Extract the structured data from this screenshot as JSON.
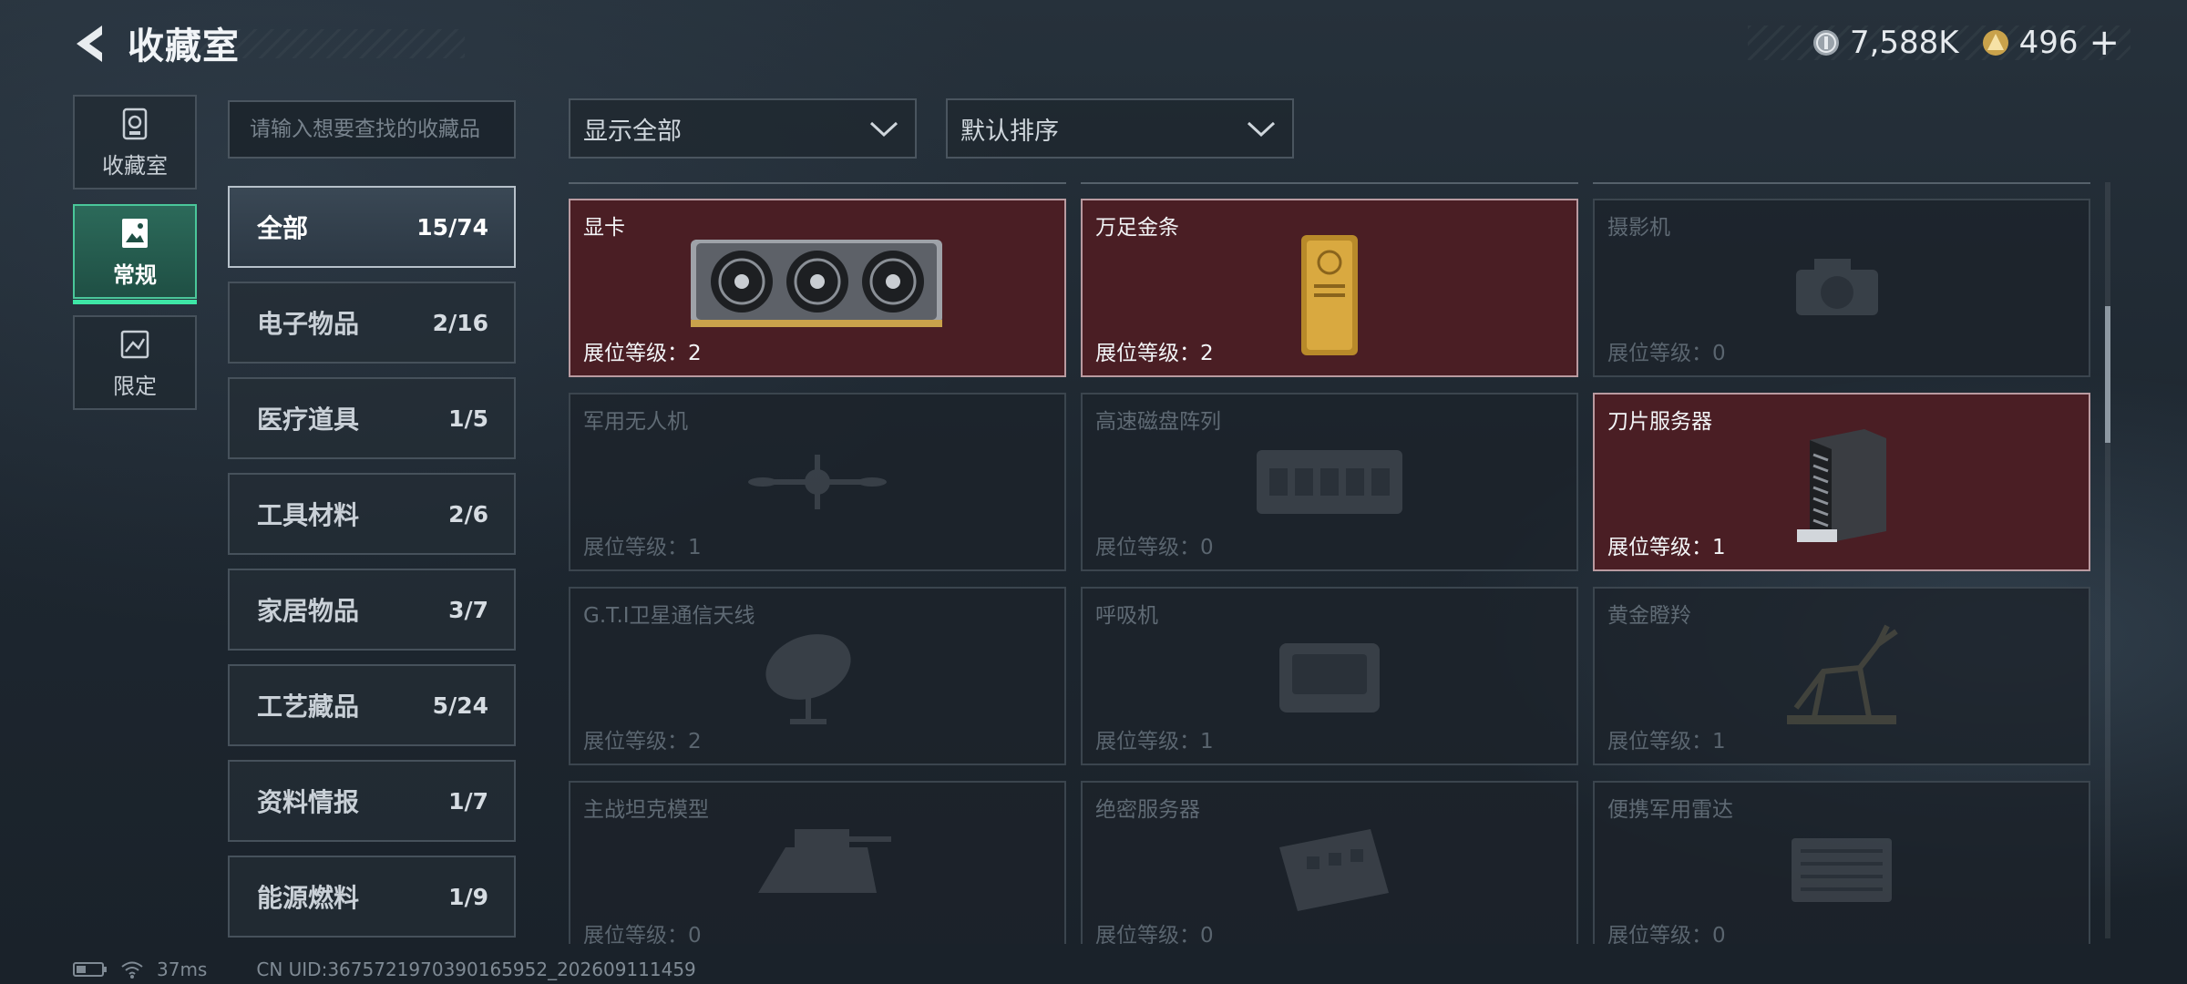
{
  "header": {
    "title": "收藏室",
    "currency_silver": "7,588K",
    "currency_gold": "496",
    "plus_label": "+"
  },
  "nav": [
    {
      "label": "收藏室",
      "icon": "trophy-icon"
    },
    {
      "label": "常规",
      "icon": "image-icon",
      "active": true
    },
    {
      "label": "限定",
      "icon": "limited-icon"
    }
  ],
  "search": {
    "placeholder": "请输入想要查找的收藏品"
  },
  "categories": [
    {
      "name": "全部",
      "count": "15/74",
      "active": true
    },
    {
      "name": "电子物品",
      "count": "2/16"
    },
    {
      "name": "医疗道具",
      "count": "1/5"
    },
    {
      "name": "工具材料",
      "count": "2/6"
    },
    {
      "name": "家居物品",
      "count": "3/7"
    },
    {
      "name": "工艺藏品",
      "count": "5/24"
    },
    {
      "name": "资料情报",
      "count": "1/7"
    },
    {
      "name": "能源燃料",
      "count": "1/9"
    }
  ],
  "filters": {
    "display": "显示全部",
    "sort": "默认排序"
  },
  "items": [
    {
      "name": "显卡",
      "level": "展位等级：2",
      "collected": true,
      "icon": "gpu-icon"
    },
    {
      "name": "万足金条",
      "level": "展位等级：2",
      "collected": true,
      "icon": "gold-bar-icon"
    },
    {
      "name": "摄影机",
      "level": "展位等级：0",
      "collected": false,
      "icon": "camera-icon"
    },
    {
      "name": "军用无人机",
      "level": "展位等级：1",
      "collected": false,
      "icon": "drone-icon"
    },
    {
      "name": "高速磁盘阵列",
      "level": "展位等级：0",
      "collected": false,
      "icon": "disk-array-icon"
    },
    {
      "name": "刀片服务器",
      "level": "展位等级：1",
      "collected": true,
      "icon": "server-icon"
    },
    {
      "name": "G.T.I卫星通信天线",
      "level": "展位等级：2",
      "collected": false,
      "icon": "satellite-dish-icon"
    },
    {
      "name": "呼吸机",
      "level": "展位等级：1",
      "collected": false,
      "icon": "ventilator-icon"
    },
    {
      "name": "黄金瞪羚",
      "level": "展位等级：1",
      "collected": false,
      "icon": "gazelle-icon"
    },
    {
      "name": "主战坦克模型",
      "level": "展位等级：0",
      "collected": false,
      "icon": "tank-icon"
    },
    {
      "name": "绝密服务器",
      "level": "展位等级：0",
      "collected": false,
      "icon": "secret-server-icon"
    },
    {
      "name": "便携军用雷达",
      "level": "展位等级：0",
      "collected": false,
      "icon": "radar-icon"
    }
  ],
  "footer": {
    "ping": "37ms",
    "uid": "CN UID:3675721970390165952_202609111459"
  },
  "colors": {
    "accent": "#3ee6a6",
    "collected_bg": "#4a1e24"
  }
}
